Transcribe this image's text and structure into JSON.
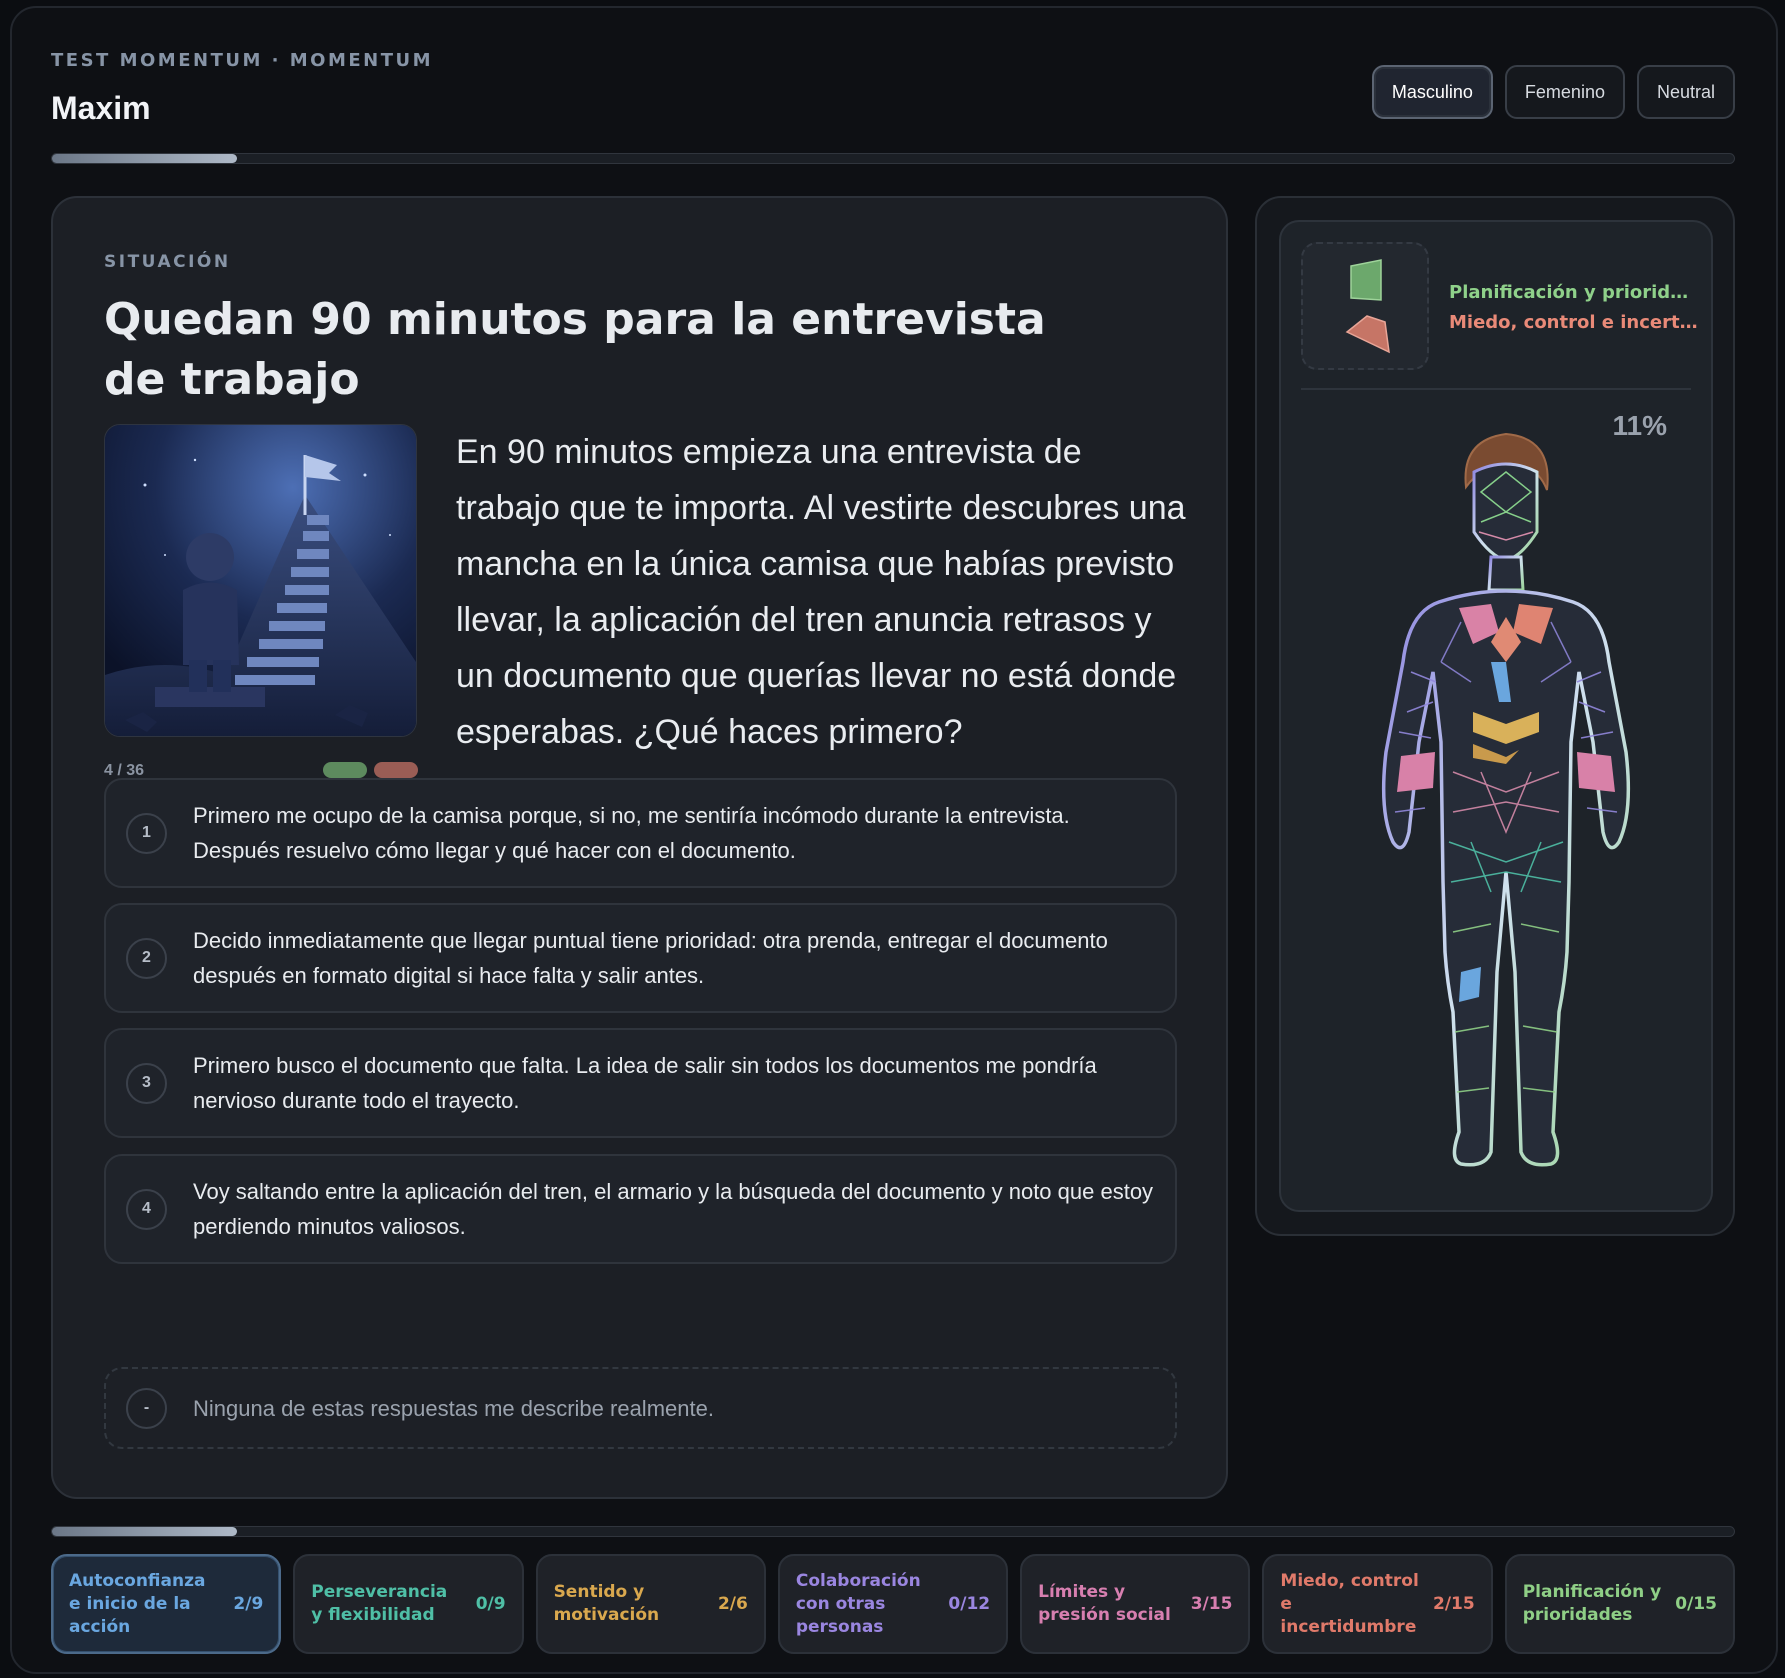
{
  "header": {
    "eyebrow": "TEST MOMENTUM · MOMENTUM",
    "user_name": "Maxim",
    "gender_options": [
      "Masculino",
      "Femenino",
      "Neutral"
    ],
    "gender_selected": "Masculino",
    "progress_fraction": 0.11
  },
  "situation": {
    "label": "SITUACIÓN",
    "title": "Quedan 90 minutos para la entrevista de trabajo",
    "text": "En 90 minutos empieza una entrevista de trabajo que te importa. Al vestirte descubres una mancha en la única camisa que habías previsto llevar, la aplicación del tren anuncia retrasos y un documento que querías llevar no está donde esperabas. ¿Qué haces primero?",
    "step": "4 / 36",
    "image_icon": "stairs-to-flag-illustration"
  },
  "options": [
    {
      "num": "1",
      "text": "Primero me ocupo de la camisa porque, si no, me sentiría incómodo durante la entrevista. Después resuelvo cómo llegar y qué hacer con el documento."
    },
    {
      "num": "2",
      "text": "Decido inmediatamente que llegar puntual tiene prioridad: otra prenda, entregar el documento después en formato digital si hace falta y salir antes."
    },
    {
      "num": "3",
      "text": "Primero busco el documento que falta. La idea de salir sin todos los documentos me pondría nervioso durante todo el trayecto."
    },
    {
      "num": "4",
      "text": "Voy saltando entre la aplicación del tren, el armario y la búsqueda del documento y noto que estoy perdiendo minutos valiosos."
    },
    {
      "num": "-",
      "text": "Ninguna de estas respuestas me describe realmente."
    }
  ],
  "side": {
    "focus": [
      {
        "text": "Planificación y prioridades",
        "color": "#8fd18a"
      },
      {
        "text": "Miedo, control e incertidumbre",
        "color": "#e98a78"
      }
    ],
    "percent": "11%"
  },
  "categories": [
    {
      "name": "Autoconfianza e inicio de la acción",
      "count": "2/9",
      "color": "#6aa7e0",
      "active": true
    },
    {
      "name": "Perseverancia y flexibilidad",
      "count": "0/9",
      "color": "#4fbfa6",
      "active": false
    },
    {
      "name": "Sentido y motivación",
      "count": "2/6",
      "color": "#d9a84e",
      "active": false
    },
    {
      "name": "Colaboración con otras personas",
      "count": "0/12",
      "color": "#9a86e0",
      "active": false
    },
    {
      "name": "Límites y presión social",
      "count": "3/15",
      "color": "#d77fb0",
      "active": false
    },
    {
      "name": "Miedo, control e incertidumbre",
      "count": "2/15",
      "color": "#e07a6a",
      "active": false
    },
    {
      "name": "Planificación y prioridades",
      "count": "0/15",
      "color": "#8fcf86",
      "active": false
    }
  ],
  "colors": {
    "background": "#0b0d11",
    "card": "#1c1f25",
    "accent": "#6aa7e0"
  }
}
